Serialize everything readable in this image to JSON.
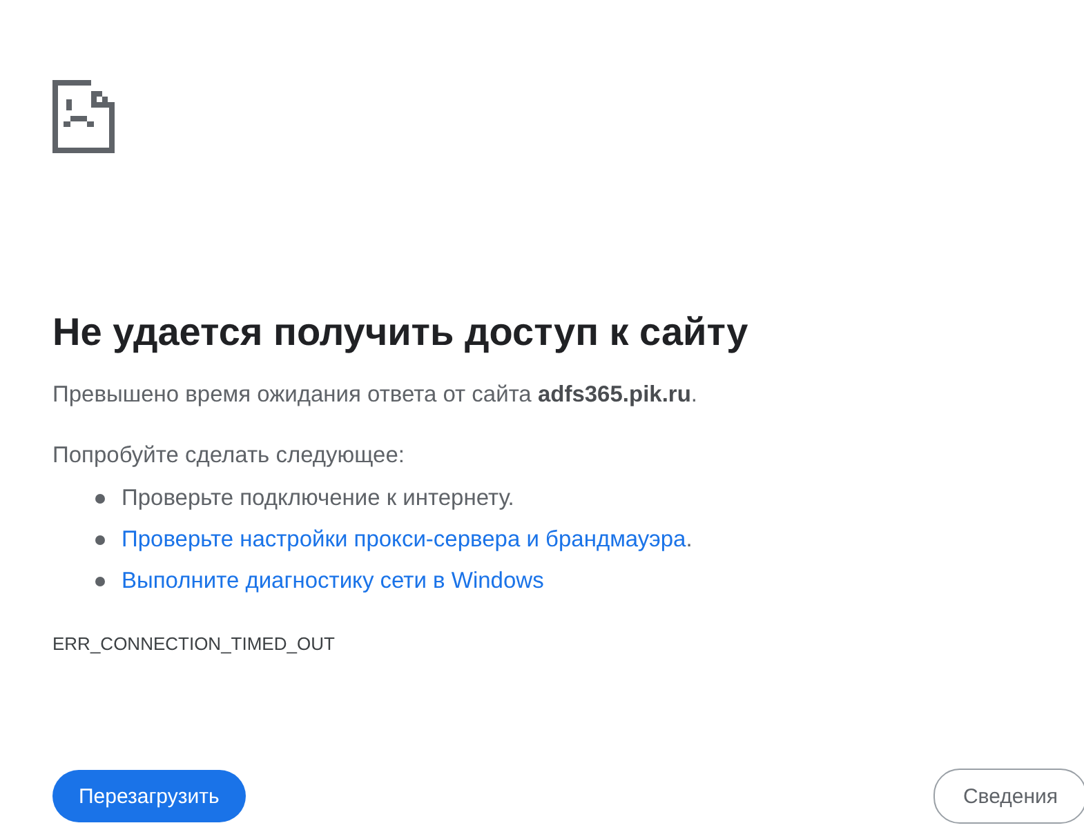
{
  "heading": "Не удается получить доступ к сайту",
  "message": "Превышено время ожидания ответа от сайта **adfs365.pik.ru**.",
  "suggestions_title": "Попробуйте сделать следующее:",
  "suggestions": [
    {
      "kind": "text",
      "text": "Проверьте подключение к интернету."
    },
    {
      "kind": "link",
      "text": "Проверьте настройки прокси-сервера и брандмауэра",
      "trail": "."
    },
    {
      "kind": "link",
      "text": "Выполните диагностику сети в Windows"
    }
  ],
  "error_code": "ERR_CONNECTION_TIMED_OUT",
  "buttons": [
    {
      "kind": "primary",
      "label": "Перезагрузить"
    },
    {
      "kind": "secondary",
      "label": "Сведения"
    }
  ]
}
